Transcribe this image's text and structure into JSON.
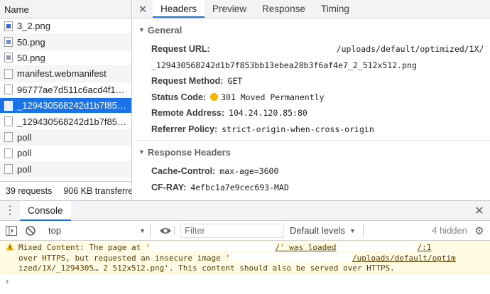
{
  "request_list": {
    "header": "Name",
    "items": [
      {
        "name": "3_2.png",
        "icon": "image-file-icon"
      },
      {
        "name": "50.png",
        "icon": "image-file-icon"
      },
      {
        "name": "50.png",
        "icon": "image-file-icon"
      },
      {
        "name": "manifest.webmanifest",
        "icon": "document-file-icon"
      },
      {
        "name": "96777ae7d511c6acd4f1…",
        "icon": "document-file-icon"
      },
      {
        "name": "_129430568242d1b7f85…",
        "icon": "document-file-icon"
      },
      {
        "name": "_129430568242d1b7f85…",
        "icon": "document-file-icon"
      },
      {
        "name": "poll",
        "icon": "document-file-icon"
      },
      {
        "name": "poll",
        "icon": "document-file-icon"
      },
      {
        "name": "poll",
        "icon": "document-file-icon"
      }
    ],
    "footer": {
      "requests": "39 requests",
      "transferred": "906 KB transferred"
    }
  },
  "detail": {
    "tabs": [
      "Headers",
      "Preview",
      "Response",
      "Timing"
    ],
    "active_tab": "Headers",
    "general": {
      "title": "General",
      "request_url_label": "Request URL:",
      "request_url_value_line1": "/uploads/default/optimized/1X/",
      "request_url_value_line2": "_129430568242d1b7f853bb13ebea28b3f6af4e7_2_512x512.png",
      "request_method_label": "Request Method:",
      "request_method_value": "GET",
      "status_code_label": "Status Code:",
      "status_code_value": "301 Moved Permanently",
      "remote_address_label": "Remote Address:",
      "remote_address_value": "104.24.120.85:80",
      "referrer_policy_label": "Referrer Policy:",
      "referrer_policy_value": "strict-origin-when-cross-origin"
    },
    "response_headers": {
      "title": "Response Headers",
      "cache_control_label": "Cache-Control:",
      "cache_control_value": "max-age=3600",
      "cf_ray_label": "CF-RAY:",
      "cf_ray_value": "4efbc1a7e9cec693-MAD"
    }
  },
  "console": {
    "tab": "Console",
    "context": "top",
    "filter_placeholder": "Filter",
    "levels": "Default levels",
    "hidden_count": "4 hidden",
    "warning": {
      "line1_a": "Mixed Content: The page at '",
      "line1_b": "/' was loaded",
      "line1_c": "/:1",
      "line2_a": "over HTTPS, but requested an insecure image '",
      "line2_b": "/uploads/default/optim",
      "line3": "ized/1X/_1294305… 2 512x512.png'. This content should also be served over HTTPS."
    },
    "prompt": "›"
  },
  "colors": {
    "accent": "#1a73e8",
    "status_dot": "#f4b400",
    "warning_bg": "#fffbe5"
  }
}
